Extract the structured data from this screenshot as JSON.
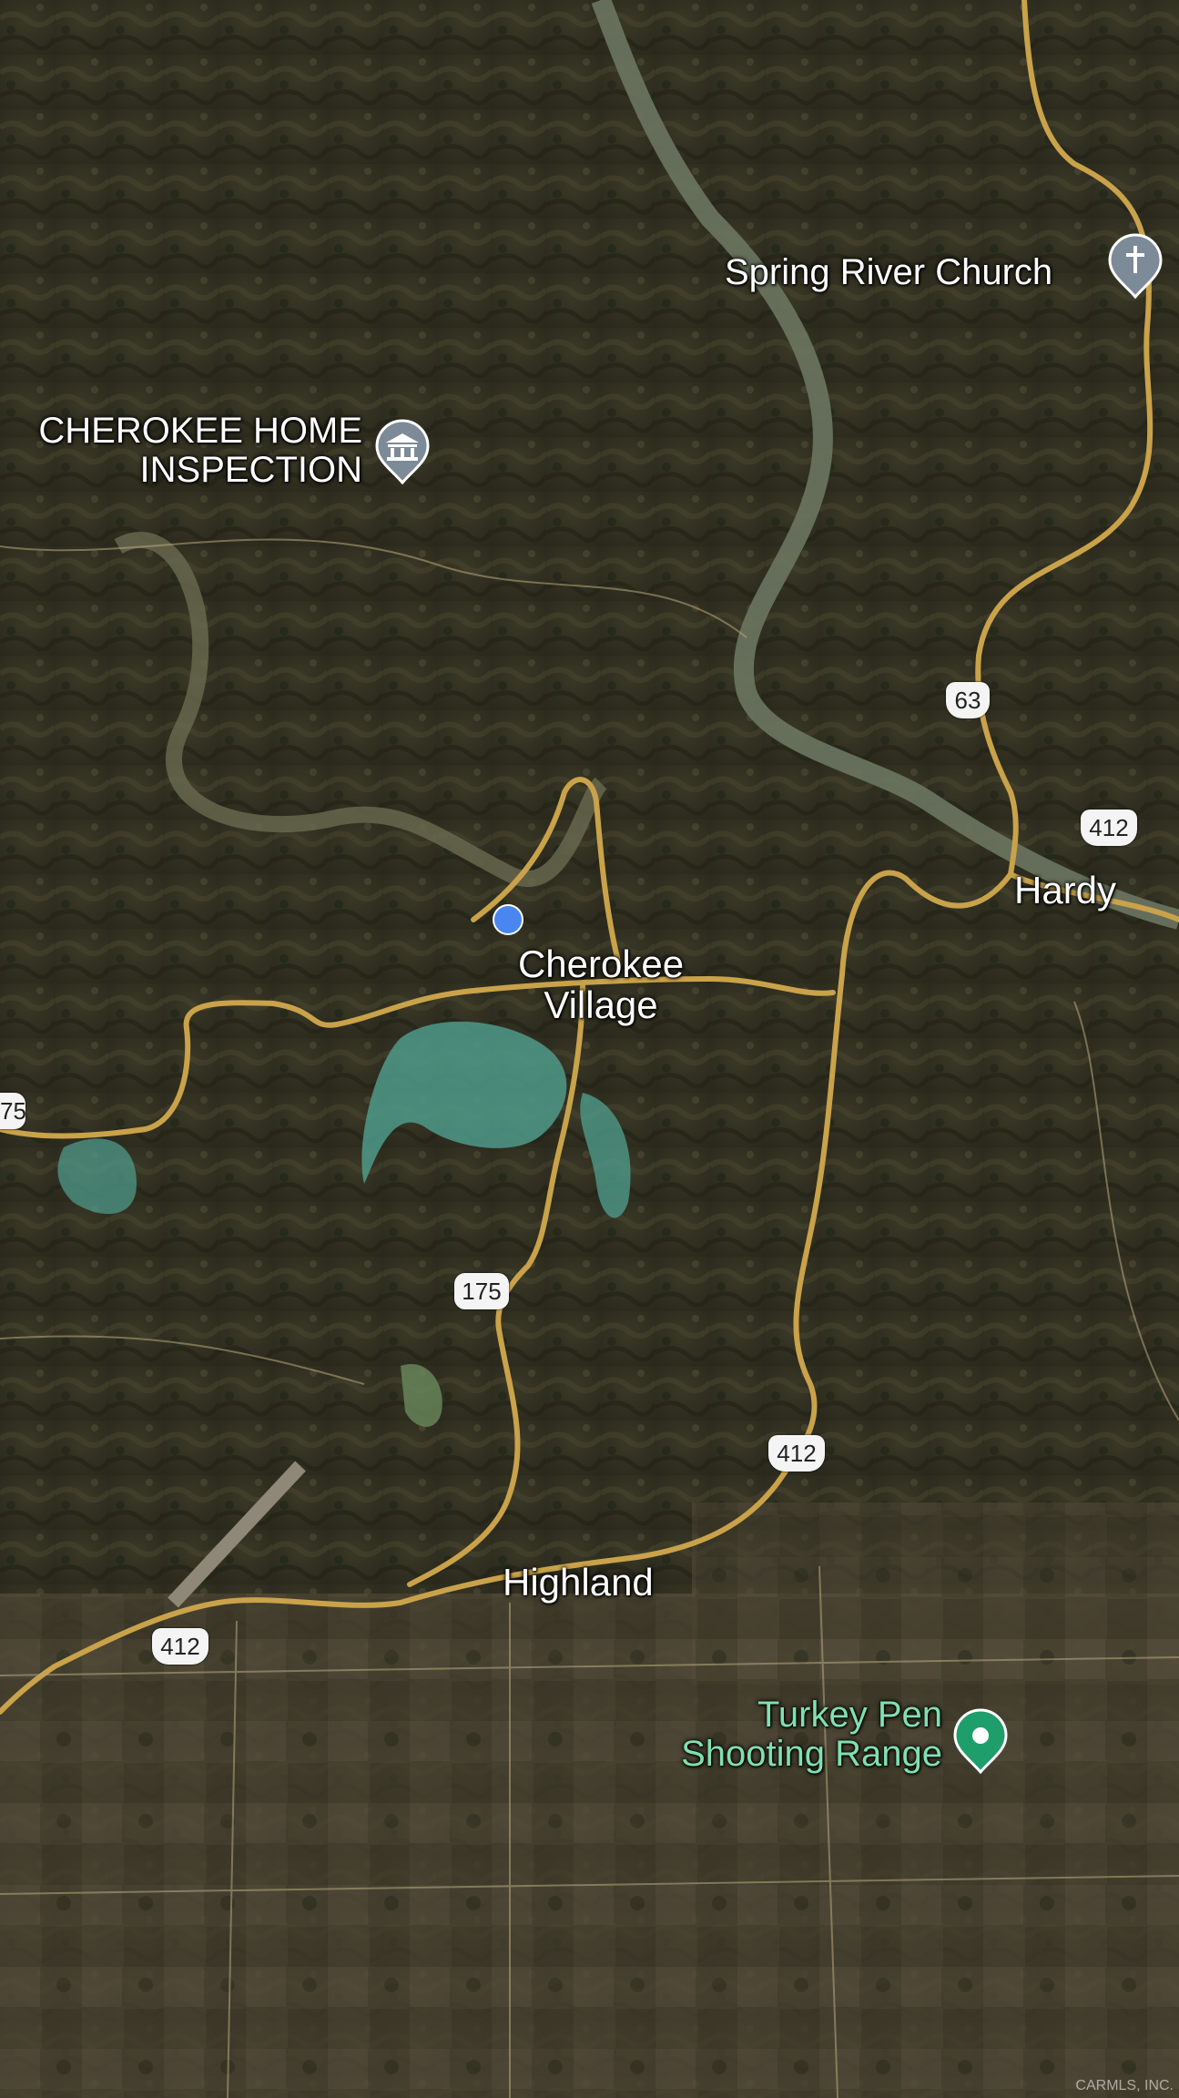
{
  "map": {
    "places": [
      {
        "name": "Spring River Church",
        "kind": "church"
      },
      {
        "name": "CHEROKEE HOME INSPECTION",
        "kind": "business"
      },
      {
        "name": "Hardy",
        "kind": "town"
      },
      {
        "name": "Cherokee Village",
        "kind": "town"
      },
      {
        "name": "Highland",
        "kind": "town"
      },
      {
        "name": "Turkey Pen Shooting Range",
        "kind": "recreation"
      }
    ],
    "labels": {
      "spring_river_church": "Spring River Church",
      "home_inspection_line1": "CHEROKEE HOME",
      "home_inspection_line2": "INSPECTION",
      "hardy": "Hardy",
      "cherokee_village_line1": "Cherokee",
      "cherokee_village_line2": "Village",
      "highland": "Highland",
      "turkey_pen_line1": "Turkey Pen",
      "turkey_pen_line2": "Shooting Range"
    },
    "route_shields": {
      "us63": "63",
      "us412_hardy": "412",
      "us412_south": "412",
      "us412_west": "412",
      "ar175": "175",
      "ar175_edge": "75"
    },
    "watermark": "CARMLS, INC.",
    "colors": {
      "road": "#c9a24a",
      "label": "#ffffff",
      "green_label": "#7fe0b0",
      "pin_gray": "#7d8a97",
      "pin_green": "#1e9e6a",
      "location_dot": "#4a86f0"
    }
  }
}
